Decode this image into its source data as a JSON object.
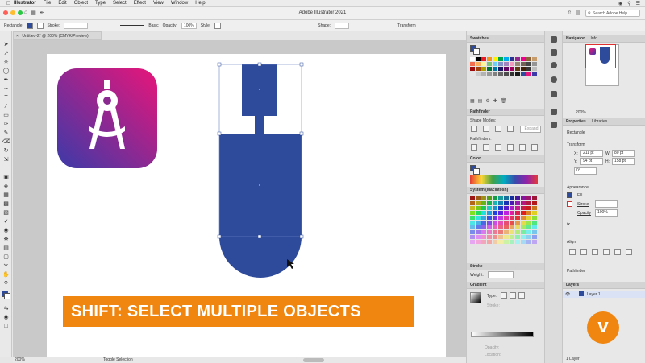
{
  "menubar": {
    "app": "Illustrator",
    "items": [
      "File",
      "Edit",
      "Object",
      "Type",
      "Select",
      "Effect",
      "View",
      "Window",
      "Help"
    ]
  },
  "appbar": {
    "title": "Adobe Illustrator 2021",
    "search_placeholder": "Search Adobe Help"
  },
  "controlbar": {
    "selection": "Rectangle",
    "stroke_label": "Stroke:",
    "brush_label": "Basic",
    "opacity_label": "Opacity:",
    "opacity_value": "100%",
    "style_label": "Style:",
    "shape_label": "Shape:",
    "transform_label": "Transform"
  },
  "document": {
    "tab_title": "Untitled-2* @ 200% (CMYK/Preview)",
    "zoom": "200%",
    "status": "Toggle Selection"
  },
  "banner": {
    "text": "SHIFT: SELECT MULTIPLE OBJECTS"
  },
  "panels": {
    "swatches": {
      "title": "Swatches"
    },
    "pathfinder": {
      "title": "Pathfinder",
      "shape_modes": "Shape Modes:",
      "pathfinders": "Pathfinders:",
      "expand": "Expand"
    },
    "color": {
      "title": "Color"
    },
    "system": {
      "title": "System (Macintosh)"
    },
    "stroke": {
      "title": "Stroke",
      "weight_label": "Weight:"
    },
    "gradient": {
      "title": "Gradient",
      "type_label": "Type:",
      "stroke_label": "Stroke:",
      "opacity_label": "Opacity:",
      "location_label": "Location:"
    },
    "navigator": {
      "tab": "Navigator",
      "tab2": "Info",
      "zoom": "200%"
    },
    "properties": {
      "tab": "Properties",
      "tab2": "Libraries",
      "selection": "Rectangle",
      "transform": "Transform",
      "x_label": "X:",
      "x": "211 pt",
      "y_label": "Y:",
      "y": "94 pt",
      "w_label": "W:",
      "w": "80 pt",
      "h_label": "H:",
      "h": "158 pt",
      "angle": "0°",
      "appearance": "Appearance",
      "fill": "Fill",
      "stroke": "Stroke",
      "opacity_label": "Opacity",
      "opacity": "100%",
      "fx": "fx.",
      "align": "Align",
      "pathfinder": "Pathfinder"
    },
    "layers": {
      "tab": "Layers",
      "layer": "Layer 1",
      "count": "1 Layer"
    }
  },
  "colors": {
    "accent_blue": "#2e4a9a",
    "banner_orange": "#f0860f",
    "icon_gradient_start": "#e8157a",
    "icon_gradient_end": "#3b3aa8"
  }
}
